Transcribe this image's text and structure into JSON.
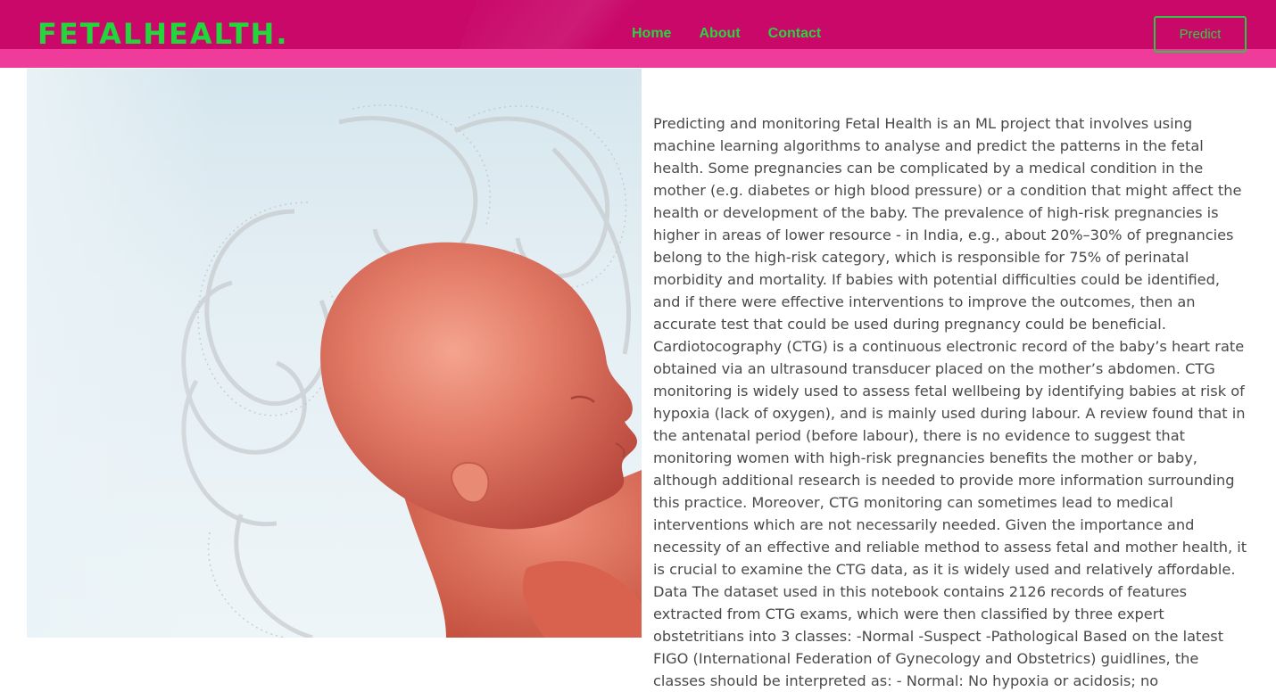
{
  "brand": "FETALHEALTH.",
  "nav": {
    "items": [
      "Home",
      "About",
      "Contact"
    ],
    "predict_label": "Predict"
  },
  "colors": {
    "navbar_bg": "#c9086a",
    "navbar_stripe": "#ef3b9a",
    "accent_green": "#29d33f",
    "body_text": "#4a4a4a"
  },
  "hero": {
    "image_subject": "fetus-illustration"
  },
  "description": "Predicting and monitoring Fetal Health is an ML project that involves using machine learning algorithms to analyse and predict the patterns in the fetal health. Some pregnancies can be complicated by a medical condition in the mother (e.g. diabetes or high blood pressure) or a condition that might affect the health or development of the baby. The prevalence of high-risk pregnancies is higher in areas of lower resource - in India, e.g., about 20%–30% of pregnancies belong to the high-risk category, which is responsible for 75% of perinatal morbidity and mortality. If babies with potential difficulties could be identified, and if there were effective interventions to improve the outcomes, then an accurate test that could be used during pregnancy could be beneficial. Cardiotocography (CTG) is a continuous electronic record of the baby’s heart rate obtained via an ultrasound transducer placed on the mother’s abdomen. CTG monitoring is widely used to assess fetal wellbeing by identifying babies at risk of hypoxia (lack of oxygen), and is mainly used during labour. A review found that in the antenatal period (before labour), there is no evidence to suggest that monitoring women with high-risk pregnancies benefits the mother or baby, although additional research is needed to provide more information surrounding this practice. Moreover, CTG monitoring can sometimes lead to medical interventions which are not necessarily needed. Given the importance and necessity of an effective and reliable method to assess fetal and mother health, it is crucial to examine the CTG data, as it is widely used and relatively affordable. Data The dataset used in this notebook contains 2126 records of features extracted from CTG exams, which were then classified by three expert obstetritians into 3 classes: -Normal -Suspect -Pathological Based on the latest FIGO (International Federation of Gynecology and Obstetrics) guidlines, the classes should be interpreted as: - Normal: No hypoxia or acidosis; no"
}
